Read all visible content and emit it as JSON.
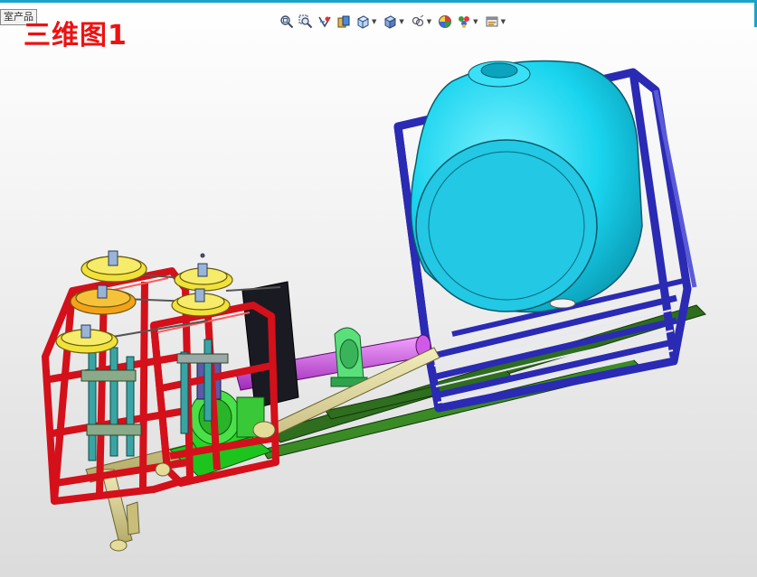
{
  "window": {
    "tree_label": "室产品",
    "view_title": "三维图1"
  },
  "toolbar": {
    "buttons": [
      {
        "icon": "zoom-fit-icon",
        "has_dropdown": false
      },
      {
        "icon": "zoom-area-icon",
        "has_dropdown": false
      },
      {
        "icon": "previous-view-icon",
        "has_dropdown": false
      },
      {
        "icon": "section-view-icon",
        "has_dropdown": false
      },
      {
        "icon": "view-orientation-icon",
        "has_dropdown": true
      },
      {
        "icon": "display-style-icon",
        "has_dropdown": true
      },
      {
        "icon": "hide-show-icon",
        "has_dropdown": true
      },
      {
        "icon": "edit-appearance-icon",
        "has_dropdown": false
      },
      {
        "icon": "apply-scene-icon",
        "has_dropdown": true
      },
      {
        "icon": "view-settings-icon",
        "has_dropdown": true
      }
    ]
  },
  "colors": {
    "title": "#ee1111",
    "tank": "#19d4ee",
    "tank_frame": "#2a2ab4",
    "pump_frames": "#d4101a",
    "pulleys": "#f0e23a",
    "motor_base": "#1ec41e",
    "shaft": "#c03ad8",
    "base_rail": "#2e6e1e",
    "pipe": "#d9cf8a"
  }
}
